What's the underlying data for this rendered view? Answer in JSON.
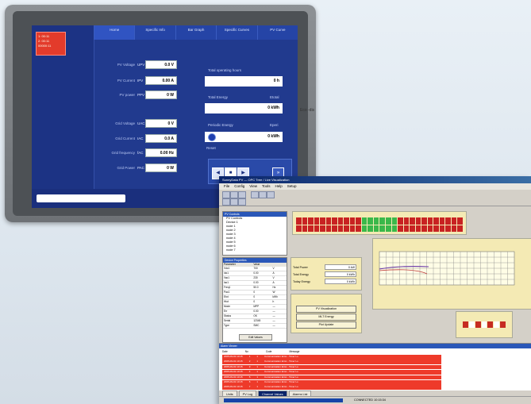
{
  "hmi": {
    "alarm_lines": [
      "1: 00:11",
      "2: 00:11",
      "00000:11"
    ],
    "tabs": [
      "Home",
      "Specific Info",
      "Bar Graph",
      "Specific Curves",
      "PV Curve"
    ],
    "pv": [
      {
        "label": "PV Voltage",
        "sym": "UPV",
        "value": "0.0 V"
      },
      {
        "label": "PV Current",
        "sym": "IPV",
        "value": "0.00 A"
      },
      {
        "label": "PV power",
        "sym": "PPV",
        "value": "0 W"
      }
    ],
    "grid": [
      {
        "label": "Grid Voltage",
        "sym": "UAC",
        "value": "0 V"
      },
      {
        "label": "Grid Current",
        "sym": "IAC",
        "value": "0.0 A"
      },
      {
        "label": "Grid frequency",
        "sym": "fAC",
        "value": "0.00 Hz"
      },
      {
        "label": "Grid Power",
        "sym": "PAC",
        "value": "0 W"
      }
    ],
    "total_hours_label": "Total operating hours",
    "total_hours_value": "0 h",
    "total_energy_label": "Total Energy",
    "total_energy_sym": "Etotal",
    "total_energy_value": "0 kWh",
    "periodic_energy_label": "Periodic Energy",
    "periodic_energy_sym": "Eperi",
    "periodic_energy_value": "0 kWh",
    "reset_label": "Reset",
    "option_label": "Option",
    "side_tag": "Eco -dis"
  },
  "app": {
    "title": "SunnyData PV — OPC Tree / Live Visualization",
    "menu": [
      "File",
      "Config",
      "View",
      "Tools",
      "Help",
      "Setup"
    ],
    "tree_header": "PV Controls",
    "tree": [
      "PV Controls",
      "Device 1",
      "node 1",
      "node 2",
      "node 3",
      "node 4",
      "node 5",
      "node 6",
      "node 7"
    ],
    "props_header": "Device Properties",
    "props_cols": [
      "Parameter",
      "Value",
      ""
    ],
    "props": [
      [
        "Vdc1",
        "700",
        "V"
      ],
      [
        "Idc1",
        "0.00",
        "A"
      ],
      [
        "Vac1",
        "230",
        "V"
      ],
      [
        "Iac1",
        "0.00",
        "A"
      ],
      [
        "Freq1",
        "50.0",
        "Hz"
      ],
      [
        "Pac1",
        "0",
        "W"
      ],
      [
        "Etot",
        "0",
        "kWh"
      ],
      [
        "Htot",
        "0",
        "h"
      ],
      [
        "Mode",
        "MPP",
        "—"
      ],
      [
        "Err",
        "0.00",
        "—"
      ],
      [
        "Status",
        "OK",
        "—"
      ],
      [
        "Serial",
        "12345",
        "—"
      ],
      [
        "Type",
        "SMC",
        "—"
      ]
    ],
    "props_footer": "Edit Values",
    "summary": [
      {
        "k": "Total Power",
        "v": "0 kW"
      },
      {
        "k": "Total Energy",
        "v": "0 kWh"
      },
      {
        "k": "Today Energy",
        "v": "0 kWh"
      }
    ],
    "buttons": [
      "PV Visualization",
      "MLT Energy",
      "Plot Update"
    ],
    "alarm_header": "Alarm Viewer",
    "alarm_cols": [
      "Date",
      "No",
      "Code",
      "Message"
    ],
    "alarms": [
      [
        "2005-09-01 10:15",
        "1",
        "1",
        "Communication Error - Timer Lo"
      ],
      [
        "2005-09-01 10:15",
        "2",
        "1",
        "Communication Error - Timer Lo"
      ],
      [
        "2005-09-01 10:15",
        "3",
        "1",
        "Communication Error - Timer Lo"
      ],
      [
        "2005-09-01 10:15",
        "4",
        "1",
        "Communication Error - Timer Lo"
      ],
      [
        "2005-09-01 10:15",
        "5",
        "1",
        "Communication Error - Timer Lo"
      ],
      [
        "2005-09-01 10:15",
        "6",
        "1",
        "Communication Error - Timer Lo"
      ],
      [
        "2005-09-01 10:15",
        "7",
        "1",
        "Communication Error - Timer Lo"
      ]
    ],
    "bottom_tabs": [
      "Units",
      "PV Log",
      "Channel Values",
      "Alarms List"
    ],
    "status_text": "CONNECTED  10:15:34"
  }
}
